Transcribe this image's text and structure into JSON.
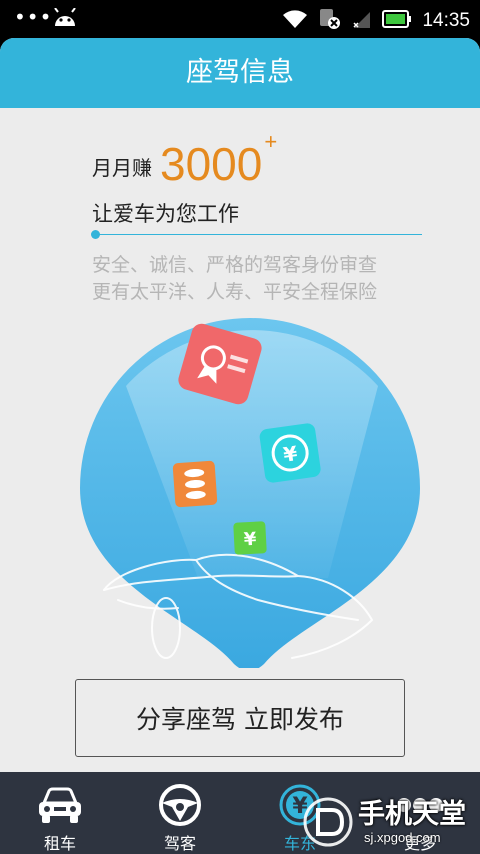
{
  "status_bar": {
    "time": "14:35",
    "dots": "•••",
    "icons": [
      "android-icon",
      "wifi-icon",
      "sim-disabled-icon",
      "signal-icon",
      "battery-icon"
    ]
  },
  "header": {
    "title": "座驾信息"
  },
  "promo": {
    "earn_prefix": "月月赚",
    "earn_amount": "3000",
    "earn_plus": "+",
    "subtitle": "让爱车为您工作",
    "desc_line1": "安全、诚信、严格的驾客身份审查",
    "desc_line2": "更有太平洋、人寿、平安全程保险"
  },
  "illustration": {
    "icons": [
      "certificate-icon",
      "yuan-card-icon",
      "coins-stack-icon",
      "yuan-small-icon",
      "car-outline"
    ],
    "colors": {
      "drop": "#4bb6e8",
      "certificate": "#f0686a",
      "yuan_card": "#2cd3de",
      "coins": "#f0883a",
      "yuan_small": "#5fd045"
    }
  },
  "cta": {
    "label": "分享座驾 立即发布"
  },
  "nav": {
    "items": [
      {
        "label": "租车",
        "icon": "car-front-icon"
      },
      {
        "label": "驾客",
        "icon": "steering-wheel-icon"
      },
      {
        "label": "车东",
        "icon": "yuan-circle-icon",
        "active": true
      },
      {
        "label": "更多",
        "icon": "more-dots-icon"
      }
    ]
  },
  "watermark": {
    "text": "手机天堂",
    "url": "sj.xpgod.com"
  },
  "colors": {
    "accent": "#33b4da",
    "orange": "#e58a1f",
    "nav_bg": "#2e3440"
  }
}
